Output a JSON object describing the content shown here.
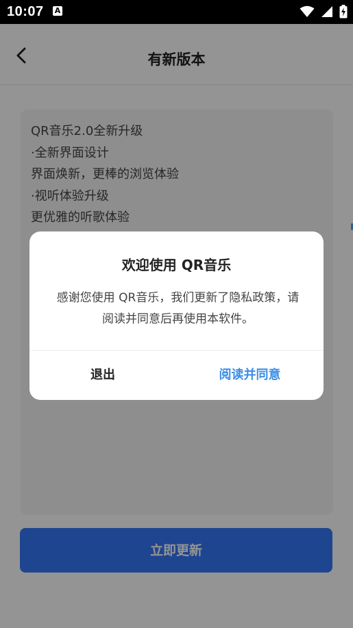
{
  "status_bar": {
    "time": "10:07",
    "notification_badge": "A",
    "icons": [
      "wifi-icon",
      "cell-signal-icon",
      "battery-charging-icon"
    ]
  },
  "toolbar": {
    "title": "有新版本",
    "back_icon": "chevron-left-icon"
  },
  "release_notes": [
    "QR音乐2.0全新升级",
    "·全新界面设计",
    "界面焕新，更棒的浏览体验",
    "·视听体验升级",
    "更优雅的听歌体验"
  ],
  "update_button": {
    "label": "立即更新"
  },
  "dialog": {
    "title": "欢迎使用 QR音乐",
    "message": "感谢您使用 QR音乐，我们更新了隐私政策，请阅读并同意后再使用本软件。",
    "exit_label": "退出",
    "agree_label": "阅读并同意"
  },
  "colors": {
    "accent": "#3478f6",
    "link": "#3a8ee6",
    "scrim": "rgba(0,0,0,0.42)"
  }
}
